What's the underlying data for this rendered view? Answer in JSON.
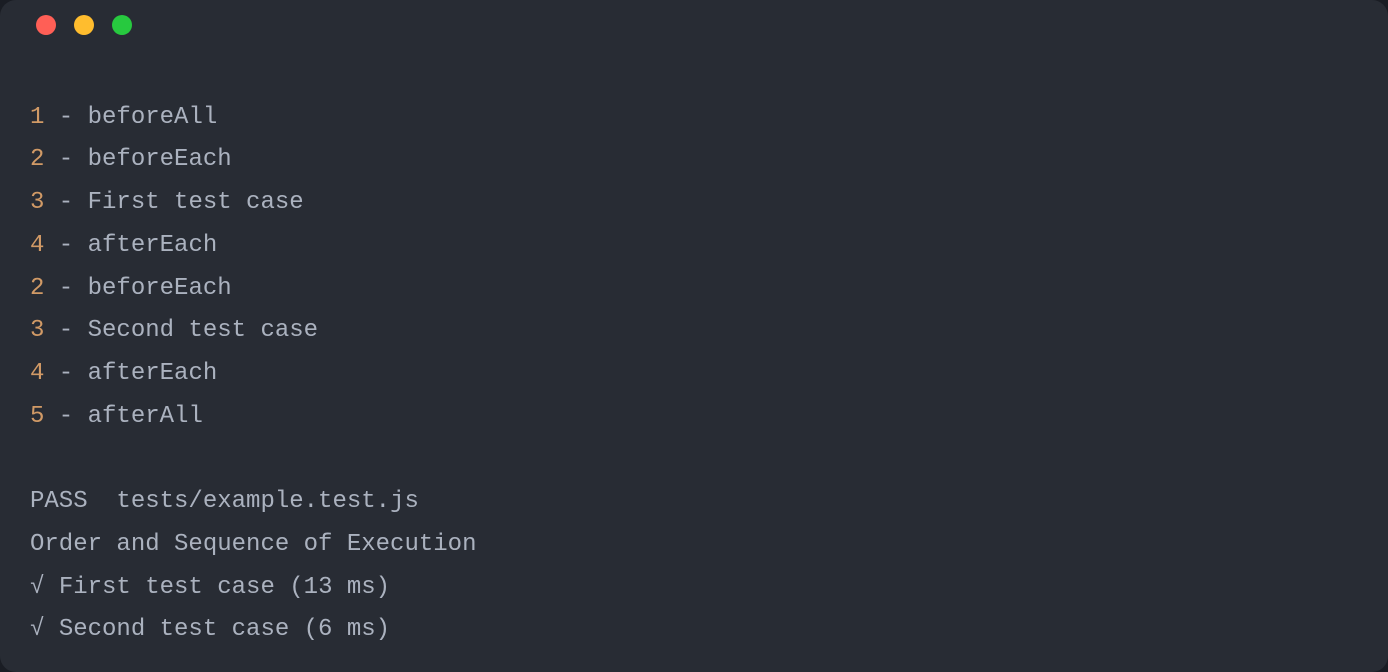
{
  "colors": {
    "background": "#282c34",
    "text": "#abb2bf",
    "number": "#d19a66",
    "dot_red": "#ff5f56",
    "dot_yellow": "#ffbd2e",
    "dot_green": "#27c93f"
  },
  "log_lines": [
    {
      "num": "1",
      "sep": " - ",
      "text": "beforeAll"
    },
    {
      "num": "2",
      "sep": " - ",
      "text": "beforeEach"
    },
    {
      "num": "3",
      "sep": " - ",
      "text": "First test case"
    },
    {
      "num": "4",
      "sep": " - ",
      "text": "afterEach"
    },
    {
      "num": "2",
      "sep": " - ",
      "text": "beforeEach"
    },
    {
      "num": "3",
      "sep": " - ",
      "text": "Second test case"
    },
    {
      "num": "4",
      "sep": " - ",
      "text": "afterEach"
    },
    {
      "num": "5",
      "sep": " - ",
      "text": "afterAll"
    }
  ],
  "result": {
    "pass_label": "PASS",
    "file": "tests/example.test.js",
    "suite": "Order and Sequence of Execution",
    "cases": [
      {
        "mark": "√",
        "name": "First test case",
        "time": "(13 ms)"
      },
      {
        "mark": "√",
        "name": "Second test case",
        "time": "(6 ms)"
      }
    ]
  }
}
